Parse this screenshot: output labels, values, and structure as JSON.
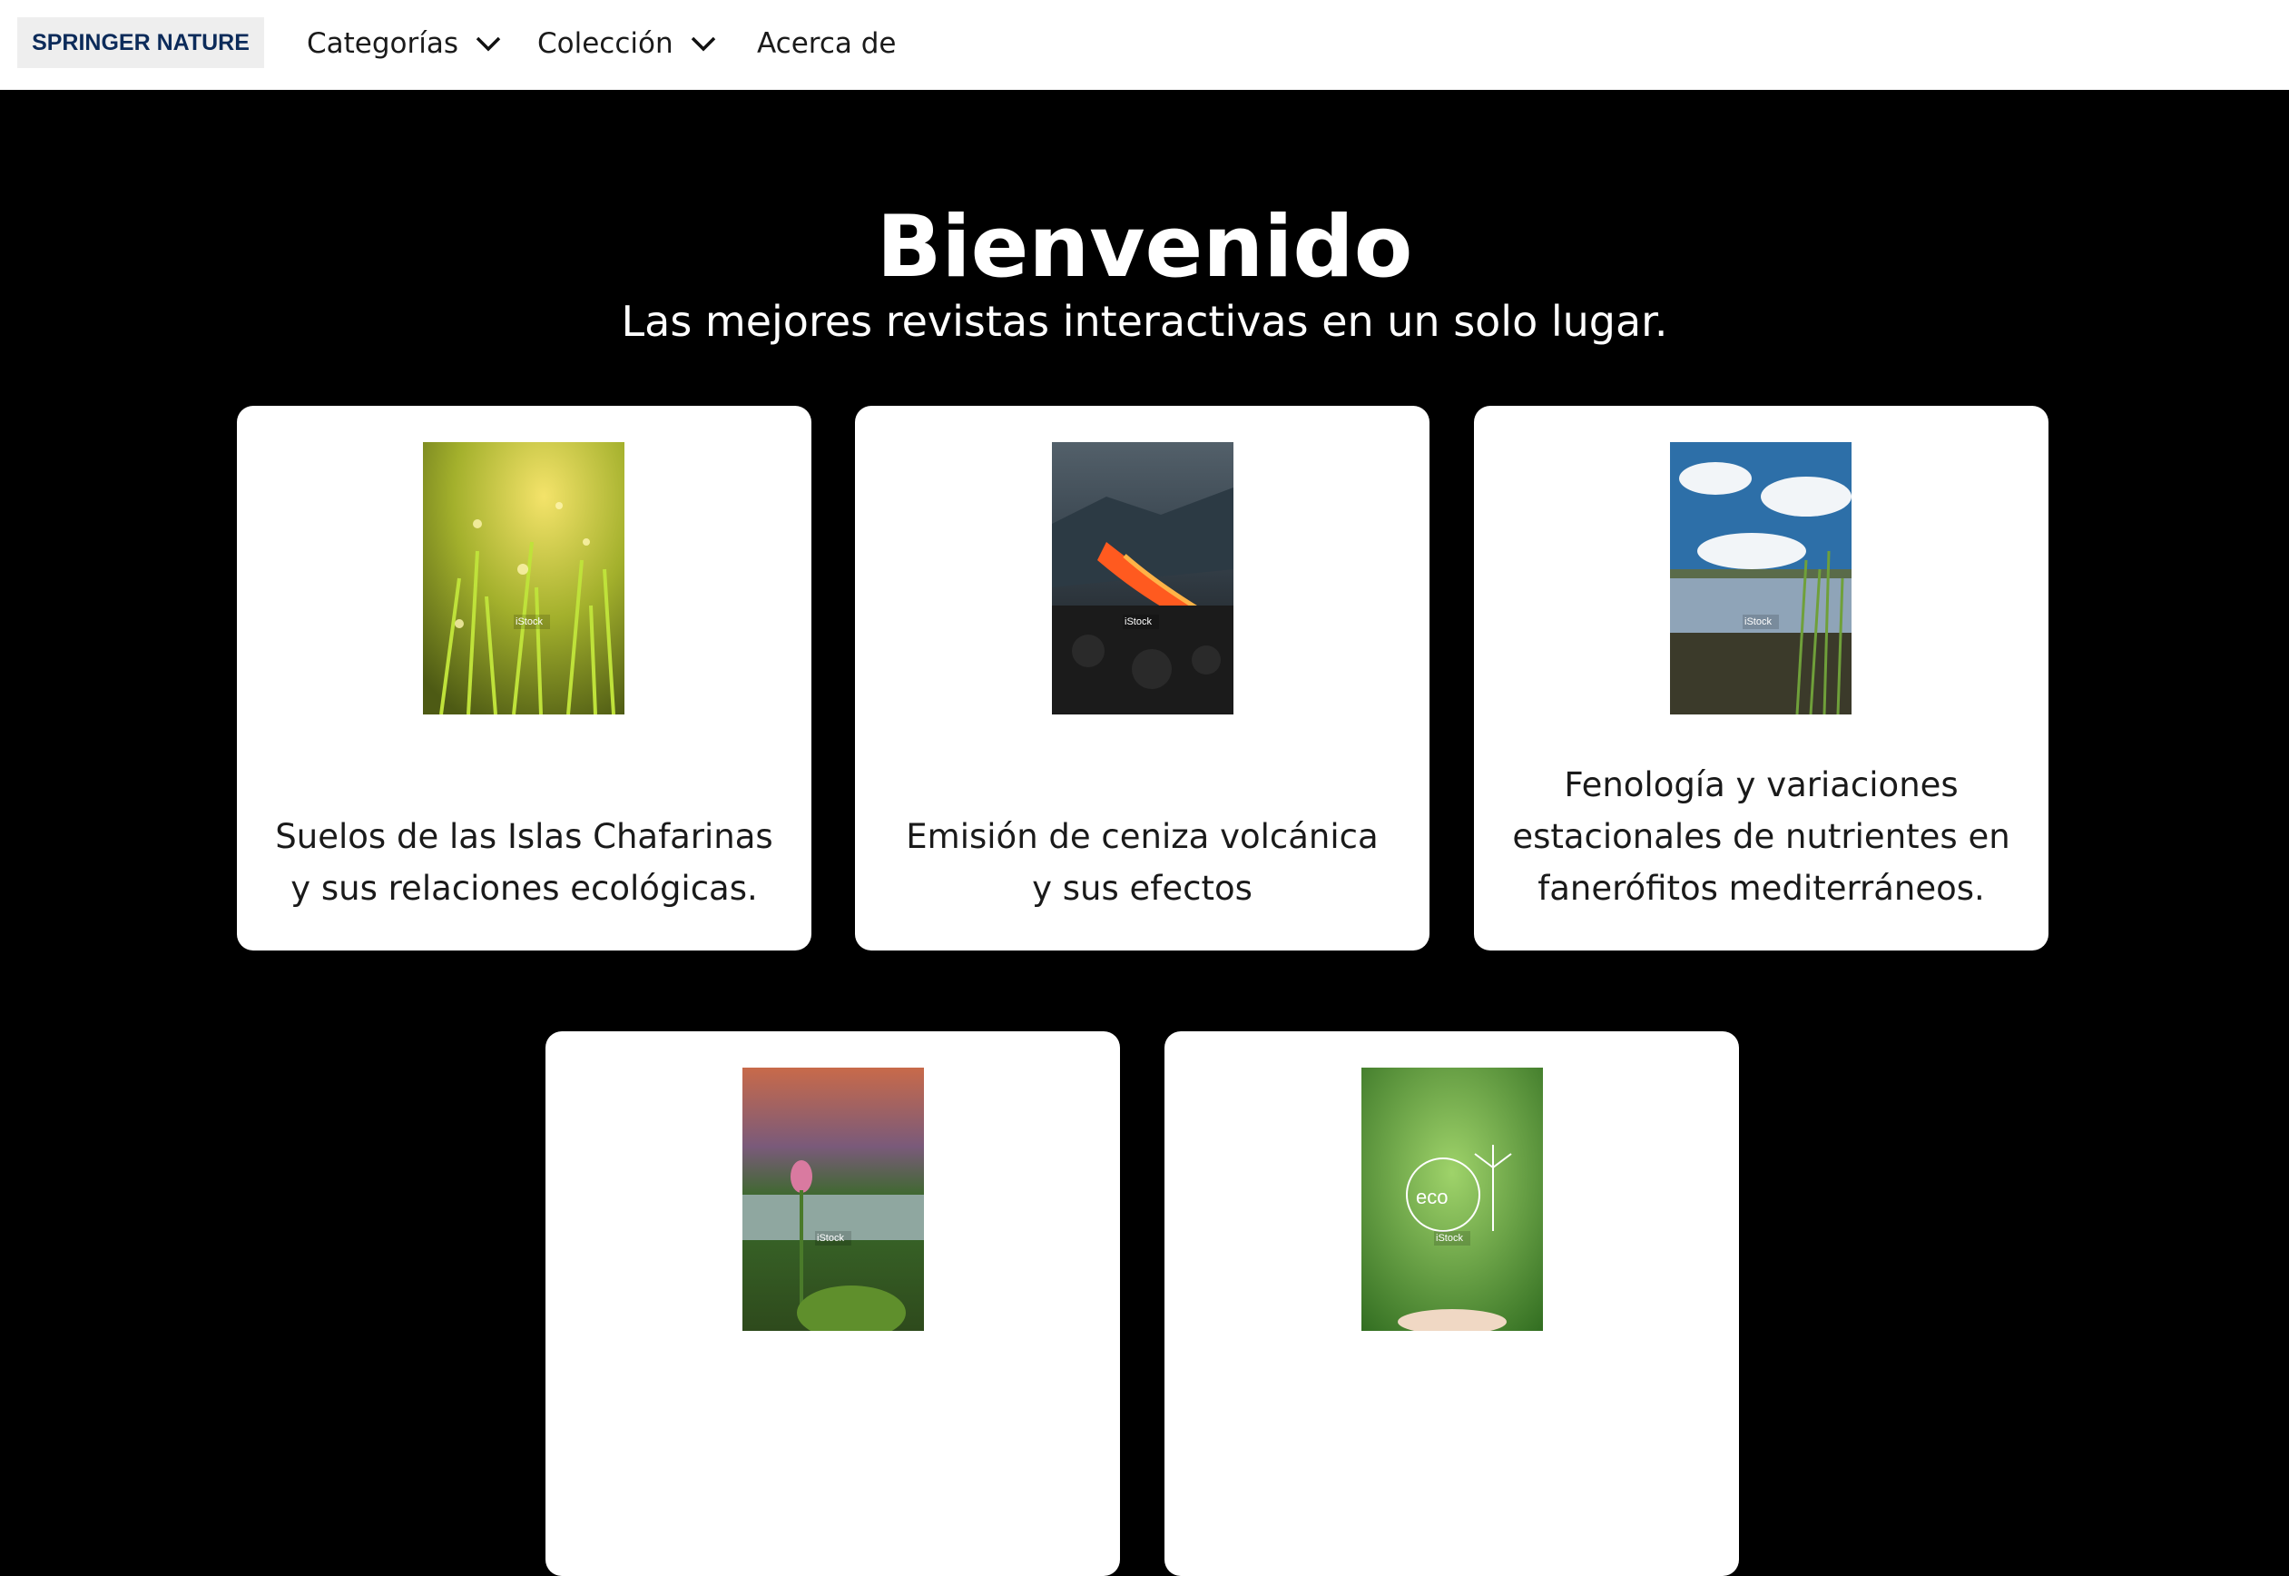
{
  "header": {
    "logo": "SPRINGER NATURE",
    "nav": [
      {
        "label": "Categorías"
      },
      {
        "label": "Colección"
      },
      {
        "label": "Acerca de"
      }
    ]
  },
  "hero": {
    "title": "Bienvenido",
    "subtitle": "Las mejores revistas interactivas en un solo lugar."
  },
  "cards": [
    {
      "title": "Suelos de las Islas Chafarinas y sus relaciones ecológicas.",
      "image": "grass-dew-cover",
      "watermark": "iStock"
    },
    {
      "title": "Emisión de ceniza volcánica y sus efectos",
      "image": "volcano-lava-cover",
      "watermark": "iStock"
    },
    {
      "title": "Fenología y variaciones estacionales de nutrientes en fanerófitos mediterráneos.",
      "image": "wetland-sky-cover",
      "watermark": "iStock"
    },
    {
      "title": "",
      "image": "orchid-forest-cover",
      "watermark": "iStock"
    },
    {
      "title": "",
      "image": "eco-energy-cover",
      "watermark": "iStock"
    }
  ]
}
